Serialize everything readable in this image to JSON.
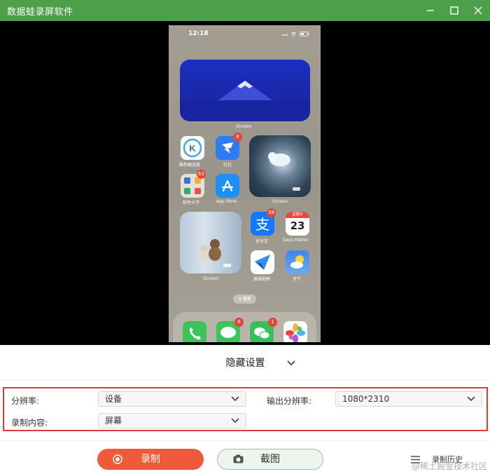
{
  "window": {
    "title": "数据蛙录屏软件",
    "colors": {
      "titlebar": "#4e9f4a",
      "accent": "#ef5a38",
      "highlight_border": "#e03a3a"
    }
  },
  "phone": {
    "time": "12:18",
    "widgets": {
      "top_label": "iScreen",
      "cat_label": "iScreen",
      "bear_label": "iScreen"
    },
    "apps": [
      {
        "name": "酷狗概念版",
        "icon": "k-app-icon"
      },
      {
        "name": "钉钉",
        "icon": "dingtalk-icon",
        "badge": "8"
      },
      {
        "name": "软件大学",
        "icon": "folder-icon",
        "badge": "63"
      },
      {
        "name": "App Store",
        "icon": "app-store-icon"
      },
      {
        "name": "支付宝",
        "icon": "alipay-icon",
        "badge": "38"
      },
      {
        "name": "Days Matter",
        "icon": "calendar-icon",
        "weekday": "星期日",
        "day": "23"
      },
      {
        "name": "高德地图",
        "icon": "amap-icon"
      },
      {
        "name": "天气",
        "icon": "weather-icon"
      }
    ],
    "search": "Q 搜索",
    "dock": [
      {
        "icon": "phone-icon"
      },
      {
        "icon": "messages-icon",
        "badge": "6"
      },
      {
        "icon": "wechat-icon",
        "badge": "1"
      },
      {
        "icon": "photos-icon"
      }
    ]
  },
  "settings": {
    "toggle_label": "隐藏设置",
    "resolution_label": "分辨率:",
    "resolution_value": "设备",
    "output_label": "输出分辨率:",
    "output_value": "1080*2310",
    "content_label": "录制内容:",
    "content_value": "屏幕"
  },
  "actions": {
    "record": "录制",
    "screenshot": "截图",
    "history": "录制历史"
  },
  "watermark": "@稀土掘金技术社区"
}
